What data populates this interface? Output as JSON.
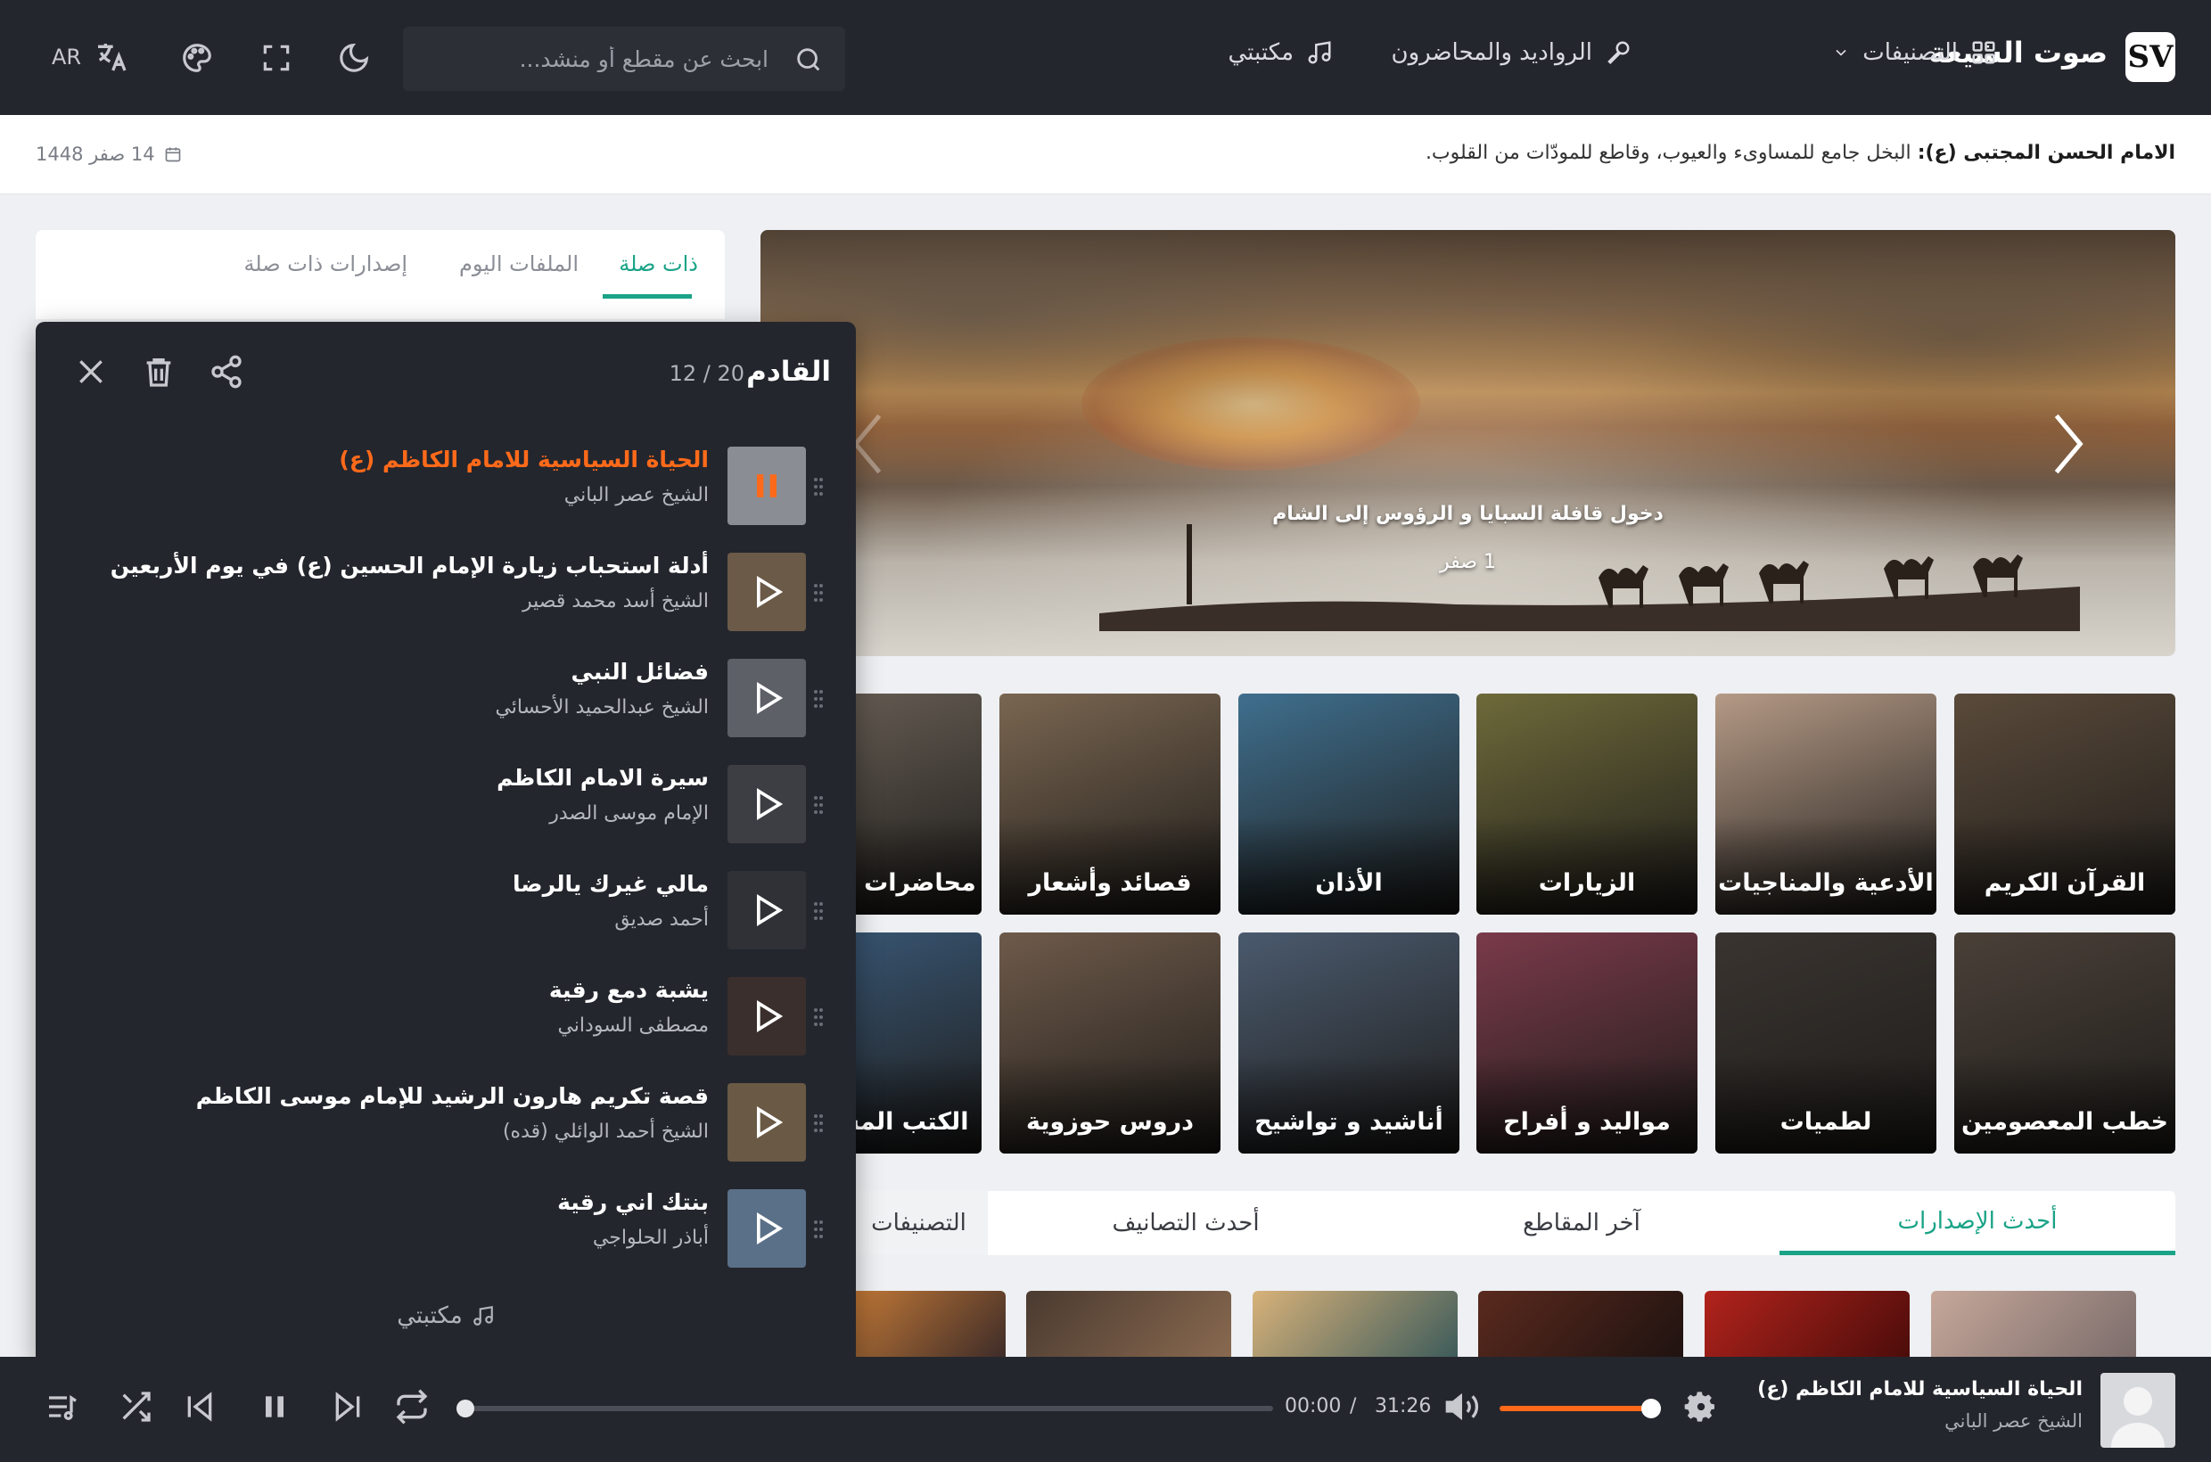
{
  "header": {
    "logo_text": "SV",
    "site_name": "صوت الشيعة",
    "nav": {
      "categories": "التصنيفات",
      "speakers": "الرواديد والمحاضرون",
      "library": "مكتبتي"
    },
    "search_placeholder": "ابحث عن مقطع أو منشد...",
    "language": "AR"
  },
  "info_bar": {
    "quote_author": "الامام الحسن المجتبى (ع):",
    "quote_text": "البخل جامع للمساوىء والعيوب، وقاطع للمودّات من القلوب.",
    "hijri_date": "14 صفر 1448"
  },
  "hero": {
    "title": "دخول قافلة السبايا و الرؤوس إلى الشام",
    "date": "1 صفر"
  },
  "categories": [
    {
      "label": "القرآن الكريم",
      "color": "#5a4a3a"
    },
    {
      "label": "الأدعية والمناجيات",
      "color": "#b59a86"
    },
    {
      "label": "الزيارات",
      "color": "#6e6a3a"
    },
    {
      "label": "الأذان",
      "color": "#3f6f8e"
    },
    {
      "label": "قصائد وأشعار",
      "color": "#7a6651"
    },
    {
      "label": "محاضرات إسلامية",
      "color": "#6b6258"
    },
    {
      "label": "خطب المعصومين",
      "color": "#4a4038"
    },
    {
      "label": "لطميات",
      "color": "#3a3430"
    },
    {
      "label": "مواليد و أفراح",
      "color": "#7a3a4a"
    },
    {
      "label": "أناشيد و تواشيح",
      "color": "#4a5a6e"
    },
    {
      "label": "دروس حوزوية",
      "color": "#6e5a4a"
    },
    {
      "label": "الكتب المسموعة",
      "color": "#3a5a7a"
    }
  ],
  "bottom_tabs": {
    "latest_releases": "أحدث الإصدارات",
    "latest_clips": "آخر المقاطع",
    "latest_categories": "أحدث التصانيف",
    "categories": "التصنيفات"
  },
  "side_tabs": {
    "related": "ذات صلة",
    "today": "الملفات اليوم",
    "related_releases": "إصدارات ذات صلة"
  },
  "queue": {
    "title": "القادم",
    "count": "12 / 20",
    "footer": "مكتبتي",
    "items": [
      {
        "title": "الحياة السياسية للامام الكاظم (ع)",
        "artist": "الشيخ عصر الباني",
        "playing": true,
        "thumb": "#8a8d93"
      },
      {
        "title": "أدلة استحباب زيارة الإمام الحسين (ع) في يوم الأربعين",
        "artist": "الشيخ أسد محمد قصير",
        "playing": false,
        "thumb": "#6b5a48"
      },
      {
        "title": "فضائل النبي",
        "artist": "الشيخ عبدالحميد الأحسائي",
        "playing": false,
        "thumb": "#5e6068"
      },
      {
        "title": "سيرة الامام الكاظم",
        "artist": "الإمام موسى الصدر",
        "playing": false,
        "thumb": "#3c3e44"
      },
      {
        "title": "مالي غيرك يالرضا",
        "artist": "أحمد صديق",
        "playing": false,
        "thumb": "#2f3136"
      },
      {
        "title": "يشبة دمع رقية",
        "artist": "مصطفى السوداني",
        "playing": false,
        "thumb": "#3a2f2c"
      },
      {
        "title": "قصة تكريم هارون الرشيد للإمام موسى الكاظم",
        "artist": "الشيخ أحمد الوائلي (قده)",
        "playing": false,
        "thumb": "#6a5a45"
      },
      {
        "title": "بنتك اني رقية",
        "artist": "أباذر الحلواجي",
        "playing": false,
        "thumb": "#5a7088"
      }
    ]
  },
  "player": {
    "title": "الحياة السياسية للامام الكاظم (ع)",
    "artist": "الشيخ عصر الباني",
    "current_time": "00:00",
    "separator": "/",
    "total_time": "31:26",
    "progress": 0,
    "volume": 1.0
  },
  "colors": {
    "accent": "#1aa387",
    "playing": "#ff6a1a",
    "dark": "#24262d"
  }
}
